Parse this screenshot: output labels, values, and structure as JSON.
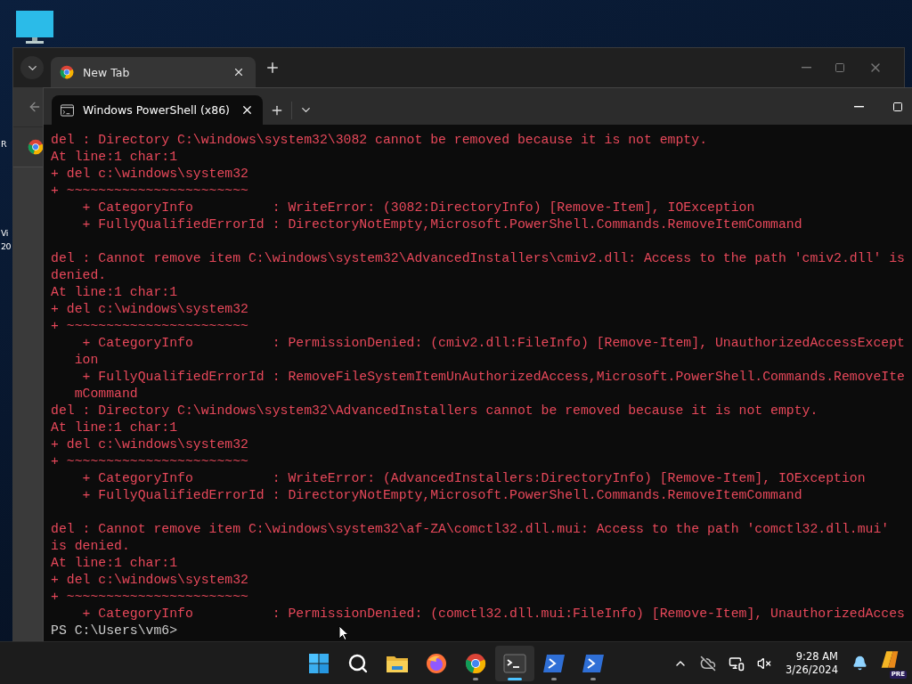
{
  "desktop": {
    "icon_labels": [
      "R",
      "Vi",
      "20"
    ]
  },
  "browser": {
    "tabs": [
      {
        "title": "New Tab",
        "selected": true
      }
    ]
  },
  "terminal": {
    "tabs": [
      {
        "title": "Windows PowerShell (x86)",
        "selected": true
      }
    ],
    "lines": [
      {
        "kind": "error",
        "text": "del : Directory C:\\windows\\system32\\3082 cannot be removed because it is not empty.",
        "space_before": false
      },
      {
        "kind": "error",
        "text": "At line:1 char:1",
        "space_before": false
      },
      {
        "kind": "error",
        "text": "+ del c:\\windows\\system32",
        "space_before": false
      },
      {
        "kind": "error",
        "text": "+ ~~~~~~~~~~~~~~~~~~~~~~~",
        "space_before": false
      },
      {
        "kind": "error",
        "text": "    + CategoryInfo          : WriteError: (3082:DirectoryInfo) [Remove-Item], IOException",
        "space_before": false
      },
      {
        "kind": "error",
        "text": "    + FullyQualifiedErrorId : DirectoryNotEmpty,Microsoft.PowerShell.Commands.RemoveItemCommand",
        "space_before": false
      },
      {
        "kind": "error",
        "text": "del : Cannot remove item C:\\windows\\system32\\AdvancedInstallers\\cmiv2.dll: Access to the path 'cmiv2.dll' is",
        "space_before": true
      },
      {
        "kind": "error",
        "text": "denied.",
        "space_before": false
      },
      {
        "kind": "error",
        "text": "At line:1 char:1",
        "space_before": false
      },
      {
        "kind": "error",
        "text": "+ del c:\\windows\\system32",
        "space_before": false
      },
      {
        "kind": "error",
        "text": "+ ~~~~~~~~~~~~~~~~~~~~~~~",
        "space_before": false
      },
      {
        "kind": "error",
        "text": "    + CategoryInfo          : PermissionDenied: (cmiv2.dll:FileInfo) [Remove-Item], UnauthorizedAccessExcept",
        "space_before": false
      },
      {
        "kind": "error",
        "text": "   ion",
        "space_before": false
      },
      {
        "kind": "error",
        "text": "    + FullyQualifiedErrorId : RemoveFileSystemItemUnAuthorizedAccess,Microsoft.PowerShell.Commands.RemoveIte",
        "space_before": false
      },
      {
        "kind": "error",
        "text": "   mCommand",
        "space_before": false
      },
      {
        "kind": "error",
        "text": "del : Directory C:\\windows\\system32\\AdvancedInstallers cannot be removed because it is not empty.",
        "space_before": false
      },
      {
        "kind": "error",
        "text": "At line:1 char:1",
        "space_before": false
      },
      {
        "kind": "error",
        "text": "+ del c:\\windows\\system32",
        "space_before": false
      },
      {
        "kind": "error",
        "text": "+ ~~~~~~~~~~~~~~~~~~~~~~~",
        "space_before": false
      },
      {
        "kind": "error",
        "text": "    + CategoryInfo          : WriteError: (AdvancedInstallers:DirectoryInfo) [Remove-Item], IOException",
        "space_before": false
      },
      {
        "kind": "error",
        "text": "    + FullyQualifiedErrorId : DirectoryNotEmpty,Microsoft.PowerShell.Commands.RemoveItemCommand",
        "space_before": false
      },
      {
        "kind": "error",
        "text": "del : Cannot remove item C:\\windows\\system32\\af-ZA\\comctl32.dll.mui: Access to the path 'comctl32.dll.mui'",
        "space_before": true
      },
      {
        "kind": "error",
        "text": "is denied.",
        "space_before": false
      },
      {
        "kind": "error",
        "text": "At line:1 char:1",
        "space_before": false
      },
      {
        "kind": "error",
        "text": "+ del c:\\windows\\system32",
        "space_before": false
      },
      {
        "kind": "error",
        "text": "+ ~~~~~~~~~~~~~~~~~~~~~~~",
        "space_before": false
      },
      {
        "kind": "error",
        "text": "    + CategoryInfo          : PermissionDenied: (comctl32.dll.mui:FileInfo) [Remove-Item], UnauthorizedAcces",
        "space_before": false
      },
      {
        "kind": "prompt",
        "text": "PS C:\\Users\\vm6>",
        "space_before": false
      }
    ]
  },
  "taskbar": {
    "apps": [
      {
        "kind": "start",
        "running": false,
        "active": false
      },
      {
        "kind": "search",
        "running": false,
        "active": false
      },
      {
        "kind": "files",
        "running": false,
        "active": false
      },
      {
        "kind": "firefox",
        "running": false,
        "active": false
      },
      {
        "kind": "chrome",
        "running": true,
        "active": false
      },
      {
        "kind": "terminal",
        "running": true,
        "active": true
      },
      {
        "kind": "powershell",
        "running": true,
        "active": false
      },
      {
        "kind": "powershell",
        "running": true,
        "active": false
      }
    ],
    "clock": {
      "time": "9:28 AM",
      "date": "3/26/2024"
    },
    "copilot_badge": "PRE"
  }
}
